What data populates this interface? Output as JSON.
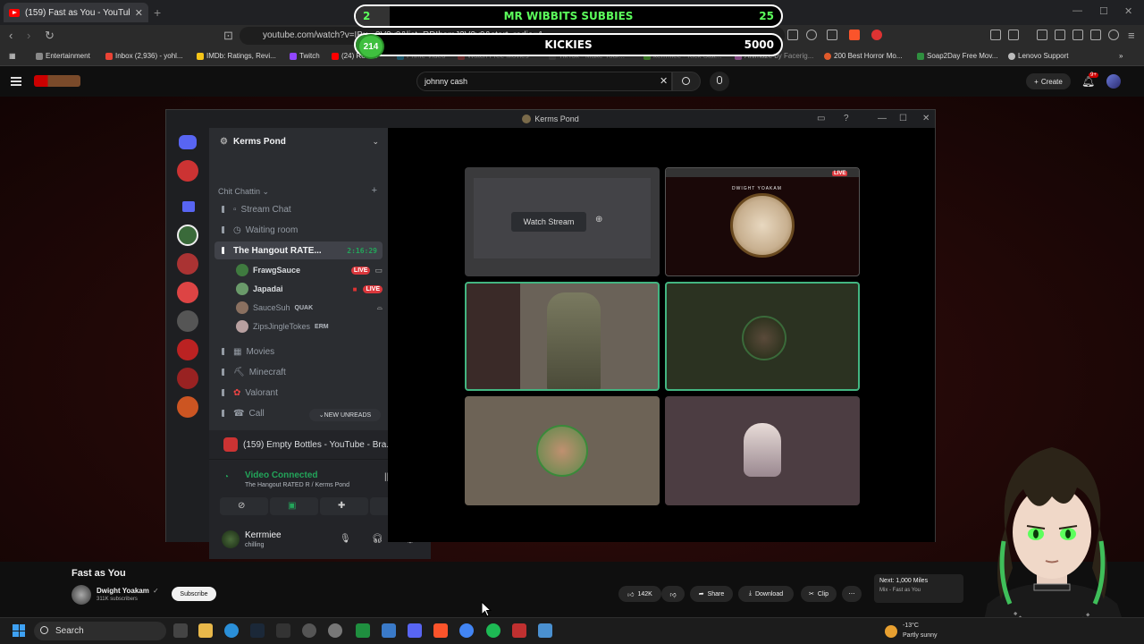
{
  "browser": {
    "tab_title": "(159) Fast as You - YouTube",
    "url": "youtube.com/watch?v=IBu...2V2v0&list=RDIbsmJ2V2v0&start_radio=1",
    "bookmarks": [
      {
        "label": "Entertainment",
        "color": "#888888"
      },
      {
        "label": "Inbox (2,936) - yohl...",
        "color": "#ea4335"
      },
      {
        "label": "IMDb: Ratings, Revi...",
        "color": "#f5c518"
      },
      {
        "label": "Twitch",
        "color": "#9146ff"
      },
      {
        "label": "(24) Reddit",
        "color": "#ff0000"
      },
      {
        "label": "Prime Video",
        "color": "#00a8e1"
      },
      {
        "label": "Watch Free Movies",
        "color": "#d33"
      },
      {
        "label": "TikTok - Make Your...",
        "color": "#111111"
      },
      {
        "label": "kerrmiee - Kick Stat...",
        "color": "#53fc18"
      },
      {
        "label": "Animaze by Facerig...",
        "color": "#cc66cc"
      },
      {
        "label": "200 Best Horror Mo...",
        "color": "#e05a2b"
      },
      {
        "label": "Soap2Day Free Mov...",
        "color": "#2f8f3f"
      },
      {
        "label": "Lenovo Support",
        "color": "#bbbbbb"
      }
    ]
  },
  "overlay": {
    "bar1": {
      "left": "2",
      "label": "MR WIBBITS SUBBIES",
      "right": "25",
      "fill_fraction": 0.08
    },
    "bar2": {
      "left": "214",
      "label": "KICKIES",
      "right": "5000",
      "fill_fraction": 0.04
    }
  },
  "youtube": {
    "search_value": "johnny cash",
    "create_label": "Create",
    "notif_count": "9+",
    "video_title": "Fast as You",
    "channel_name": "Dwight Yoakam",
    "channel_subs": "311K subscribers",
    "subscribe_label": "Subscribe",
    "likes": "142K",
    "share_label": "Share",
    "download_label": "Download",
    "clip_label": "Clip",
    "next_label": "Next: 1,000 Miles",
    "next_sub": "Mix - Fast as You"
  },
  "discord": {
    "window_title": "Kerms Pond",
    "server_name": "Kerms Pond",
    "category": "Chit Chattin",
    "channels": [
      {
        "label": "Stream Chat",
        "icon": "pin-icon"
      },
      {
        "label": "Waiting room",
        "icon": "clock-icon"
      },
      {
        "label": "The Hangout RATE...",
        "icon": "speaker-icon",
        "timer": "2:16:29"
      },
      {
        "label": "Movies",
        "icon": "film-icon"
      },
      {
        "label": "Minecraft",
        "icon": "pickaxe-icon"
      },
      {
        "label": "Valorant",
        "icon": "flower-icon"
      },
      {
        "label": "Call",
        "icon": "call-icon"
      }
    ],
    "members": [
      {
        "name": "FrawgSauce",
        "badge": "LIVE",
        "color": "#3f7a3f"
      },
      {
        "name": "Japadai",
        "badge": "LIVE",
        "color": "#6a9a6a"
      },
      {
        "name": "SauceSuh",
        "badge": "QUAK",
        "color": "#8a7060"
      },
      {
        "name": "ZipsJingleTokes",
        "badge": "ERM",
        "color": "#b8a0a0"
      }
    ],
    "new_unreads": "NEW UNREADS",
    "activity": "(159) Empty Bottles - YouTube - Bra...",
    "voice_status": "Video Connected",
    "voice_channel": "The Hangout RATED R / Kerms Pond",
    "user_name": "Kerrmiee",
    "user_status": "chilling",
    "watch_stream": "Watch Stream",
    "live_badge": "LIVE",
    "stream_label": "DWIGHT YOAKAM"
  },
  "taskbar": {
    "search_label": "Search",
    "temp": "-13°C",
    "weather": "Partly sunny"
  }
}
